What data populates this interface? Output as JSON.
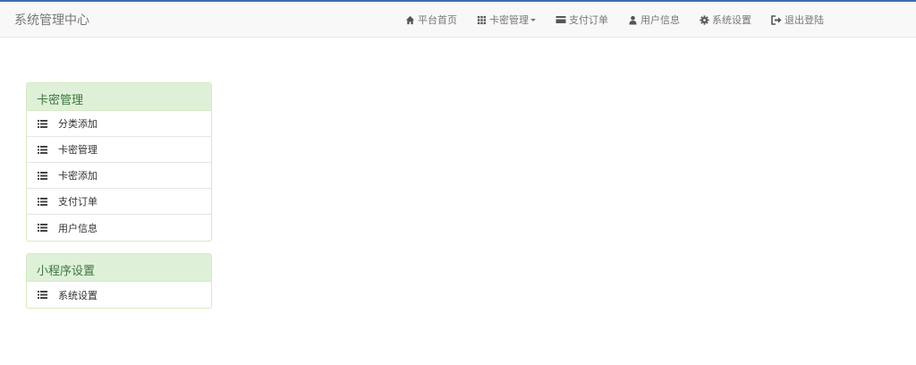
{
  "navbar": {
    "brand": "系统管理中心",
    "items": [
      {
        "label": "平台首页",
        "icon": "home-icon"
      },
      {
        "label": "卡密管理",
        "icon": "grid-icon",
        "dropdown": true
      },
      {
        "label": "支付订单",
        "icon": "card-icon"
      },
      {
        "label": "用户信息",
        "icon": "user-icon"
      },
      {
        "label": "系统设置",
        "icon": "gear-icon"
      },
      {
        "label": "退出登陆",
        "icon": "logout-icon"
      }
    ]
  },
  "panels": [
    {
      "title": "卡密管理",
      "items": [
        {
          "label": "分类添加",
          "icon": "list-icon"
        },
        {
          "label": "卡密管理",
          "icon": "list-icon"
        },
        {
          "label": "卡密添加",
          "icon": "list-icon"
        },
        {
          "label": "支付订单",
          "icon": "list-icon"
        },
        {
          "label": "用户信息",
          "icon": "list-icon"
        }
      ]
    },
    {
      "title": "小程序设置",
      "items": [
        {
          "label": "系统设置",
          "icon": "list-icon"
        }
      ]
    }
  ],
  "colors": {
    "top_accent": "#3b6db3",
    "navbar_bg": "#f8f8f8",
    "panel_heading_bg": "#dff0d8",
    "panel_heading_text": "#3c763d",
    "panel_border": "#d6e9c6"
  }
}
